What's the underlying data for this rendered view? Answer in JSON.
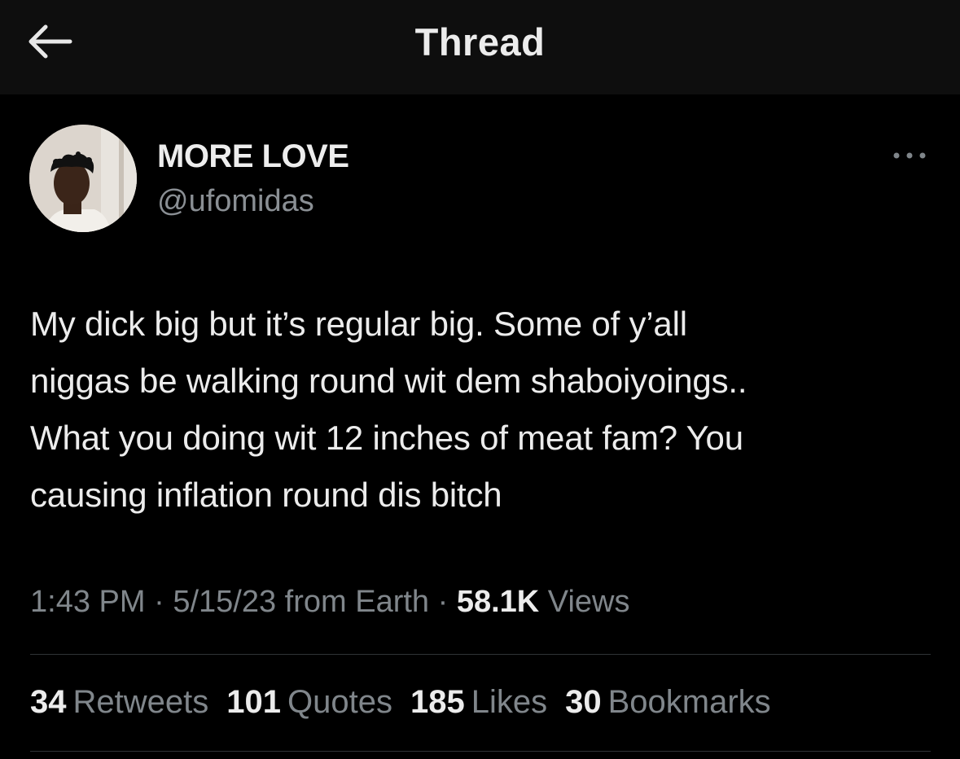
{
  "header": {
    "title": "Thread",
    "back_icon": "arrow-left-icon"
  },
  "author": {
    "display_name": "MORE LOVE",
    "handle": "@ufomidas",
    "avatar": "profile-photo",
    "more_icon": "ellipsis-icon"
  },
  "tweet": {
    "lines": [
      "My dick big but it’s regular big. Some of y’all",
      "niggas be walking round wit dem shaboiyoings..",
      "What you doing wit 12 inches of meat fam? You",
      "causing inflation round dis bitch"
    ]
  },
  "meta": {
    "time": "1:43 PM",
    "sep1": " · ",
    "date": "5/15/23",
    "source": " from Earth",
    "sep2": " · ",
    "views_count": "58.1K",
    "views_label": " Views"
  },
  "stats": [
    {
      "count": "34",
      "label": "Retweets"
    },
    {
      "count": "101",
      "label": "Quotes"
    },
    {
      "count": "185",
      "label": "Likes"
    },
    {
      "count": "30",
      "label": "Bookmarks"
    }
  ],
  "colors": {
    "background": "#000000",
    "header_bg": "#0e0e0e",
    "text": "#e7e9ea",
    "muted": "#80868b",
    "divider": "#2f3336"
  }
}
